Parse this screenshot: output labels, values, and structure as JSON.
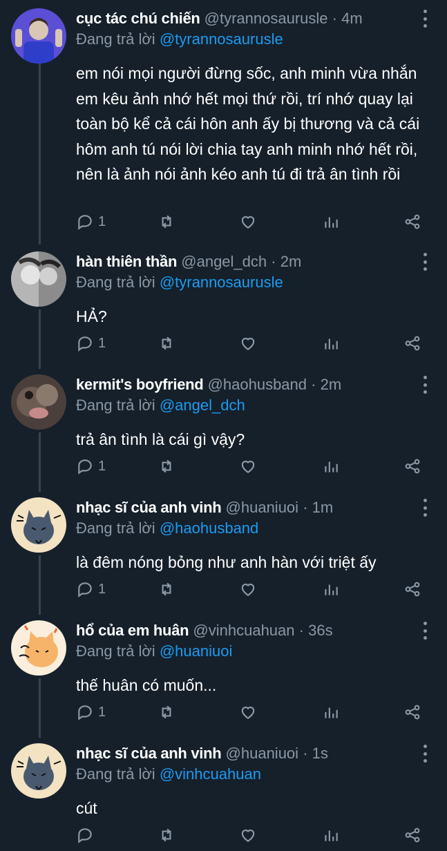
{
  "reply_prefix": "Đang trả lời",
  "separator": "·",
  "tweets": [
    {
      "name": "cục tác chú chiến",
      "handle": "@tyrannosaurusle",
      "time": "4m",
      "reply_to": "@tyrannosaurusle",
      "text": "em nói mọi người đừng sốc, anh minh vừa nhắn em kêu ảnh nhớ hết mọi thứ rồi, trí nhớ quay lại toàn bộ kể cả cái hôn anh ấy bị thương và cả cái hôm anh tú nói lời chia tay anh minh nhớ hết rồi, nên là ảnh nói ảnh kéo anh tú đi trả ân tình rồi",
      "reply_count": "1"
    },
    {
      "name": "hàn thiên thần",
      "handle": "@angel_dch",
      "time": "2m",
      "reply_to": "@tyrannosaurusle",
      "text": "HẢ?",
      "reply_count": "1"
    },
    {
      "name": "kermit's boyfriend",
      "handle": "@haohusband",
      "time": "2m",
      "reply_to": "@angel_dch",
      "text": "trả ân tình là cái gì vậy?",
      "reply_count": "1"
    },
    {
      "name": "nhạc sĩ của anh vinh",
      "handle": "@huaniuoi",
      "time": "1m",
      "reply_to": "@haohusband",
      "text": "là đêm nóng bỏng như anh hàn với triệt ấy",
      "reply_count": "1"
    },
    {
      "name": "hổ của em huân",
      "handle": "@vinhcuahuan",
      "time": "36s",
      "reply_to": "@huaniuoi",
      "text": "thế huân có muốn...",
      "reply_count": "1"
    },
    {
      "name": "nhạc sĩ của anh vinh",
      "handle": "@huaniuoi",
      "time": "1s",
      "reply_to": "@vinhcuahuan",
      "text": "cút",
      "reply_count": ""
    }
  ]
}
